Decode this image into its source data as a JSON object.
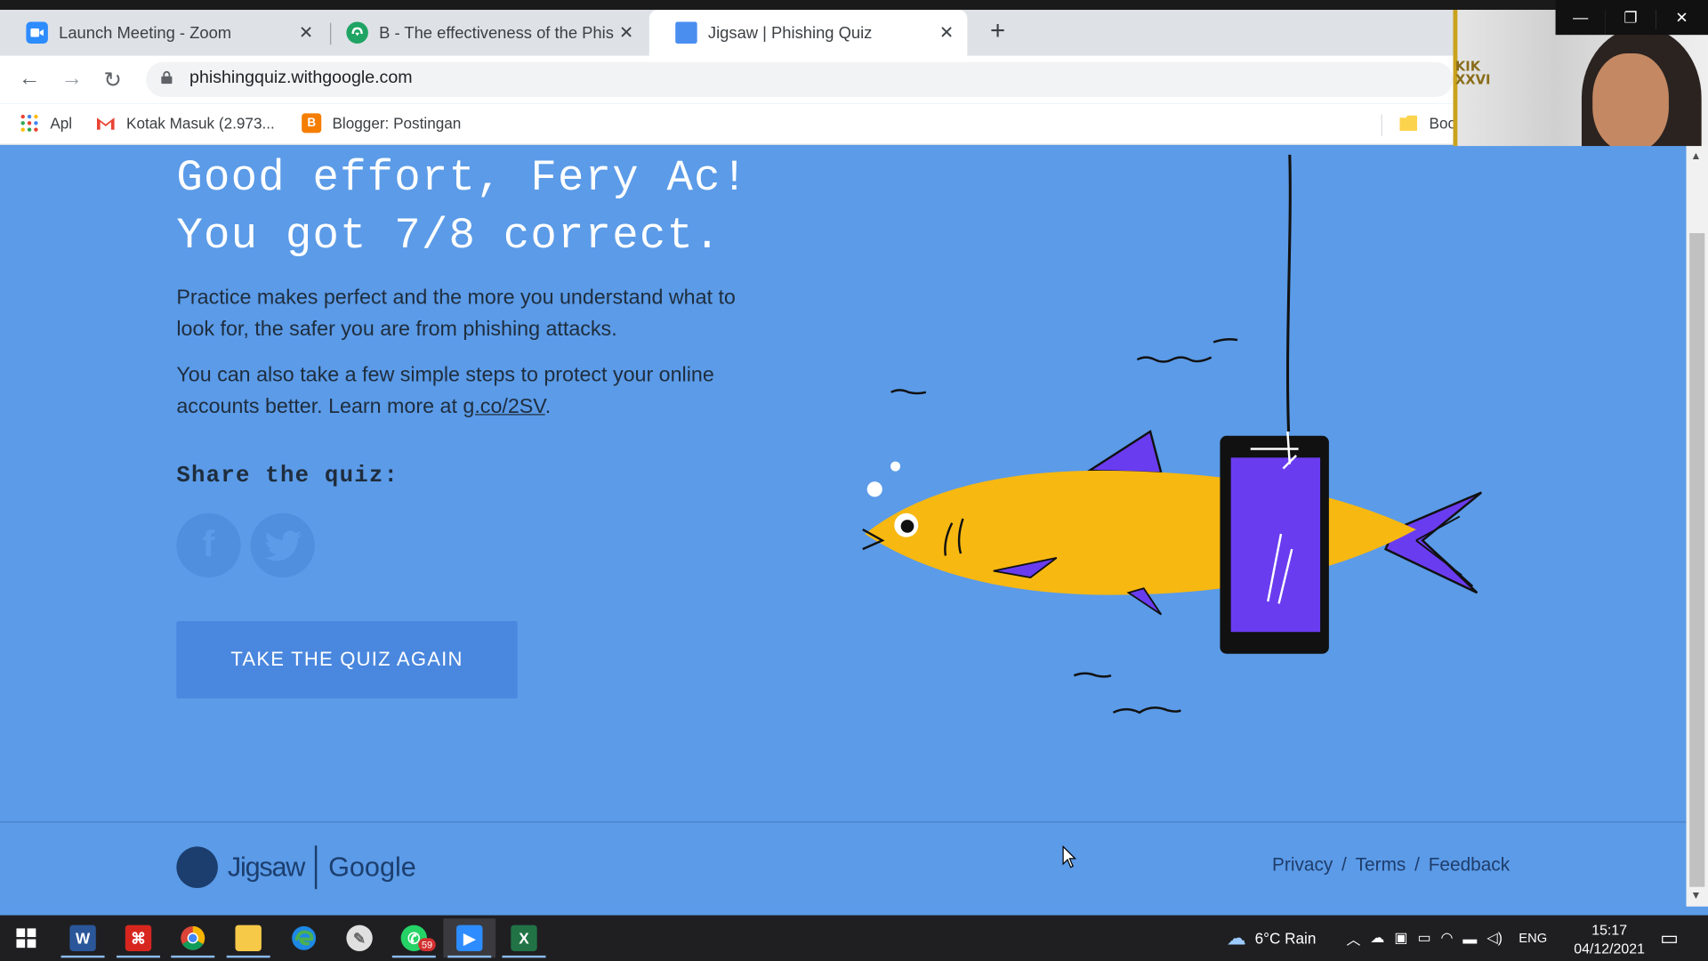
{
  "browser": {
    "tabs": [
      {
        "title": "Launch Meeting - Zoom",
        "icon": "zoom-icon"
      },
      {
        "title": "B - The effectiveness of the Phish",
        "icon": "cloud-icon"
      },
      {
        "title": "Jigsaw | Phishing Quiz",
        "icon": "page-icon"
      }
    ],
    "url": "phishingquiz.withgoogle.com",
    "bookmarks": [
      {
        "label": "Apl",
        "icon": "apps-grid-icon"
      },
      {
        "label": "Kotak Masuk (2.973...",
        "icon": "gmail-icon"
      },
      {
        "label": "Blogger: Postingan",
        "icon": "blogger-icon"
      },
      {
        "label": "Boo",
        "icon": "folder-icon"
      }
    ]
  },
  "video": {
    "logo_text": "KIK\nXXVI"
  },
  "result": {
    "headline_line1": "Good effort, Fery Ac!",
    "headline_line2": "You got 7/8 correct.",
    "para1": "Practice makes perfect and the more you understand what to look for, the safer you are from phishing attacks.",
    "para2_prefix": "You can also take a few simple steps to protect your online accounts better. Learn more at ",
    "para2_link": "g.co/2SV",
    "para2_suffix": ".",
    "share_label": "Share the quiz:",
    "facebook_glyph": "f",
    "twitter_glyph": "✶",
    "button_label": "TAKE THE QUIZ AGAIN"
  },
  "footer": {
    "brand_jigsaw": "Jigsaw",
    "brand_google": "Google",
    "links": [
      "Privacy",
      "Terms",
      "Feedback"
    ],
    "separator": "/"
  },
  "taskbar": {
    "weather": "6°C Rain",
    "lang": "ENG",
    "time": "15:17",
    "date": "04/12/2021",
    "whatsapp_badge": "59",
    "word_letter": "W",
    "excel_letter": "X"
  },
  "colors": {
    "page_bg": "#5b9be8",
    "button_bg": "#4a87de",
    "fish_body": "#f7b812",
    "fish_fin": "#6a3cf0",
    "phone_screen": "#6a3cf0"
  }
}
